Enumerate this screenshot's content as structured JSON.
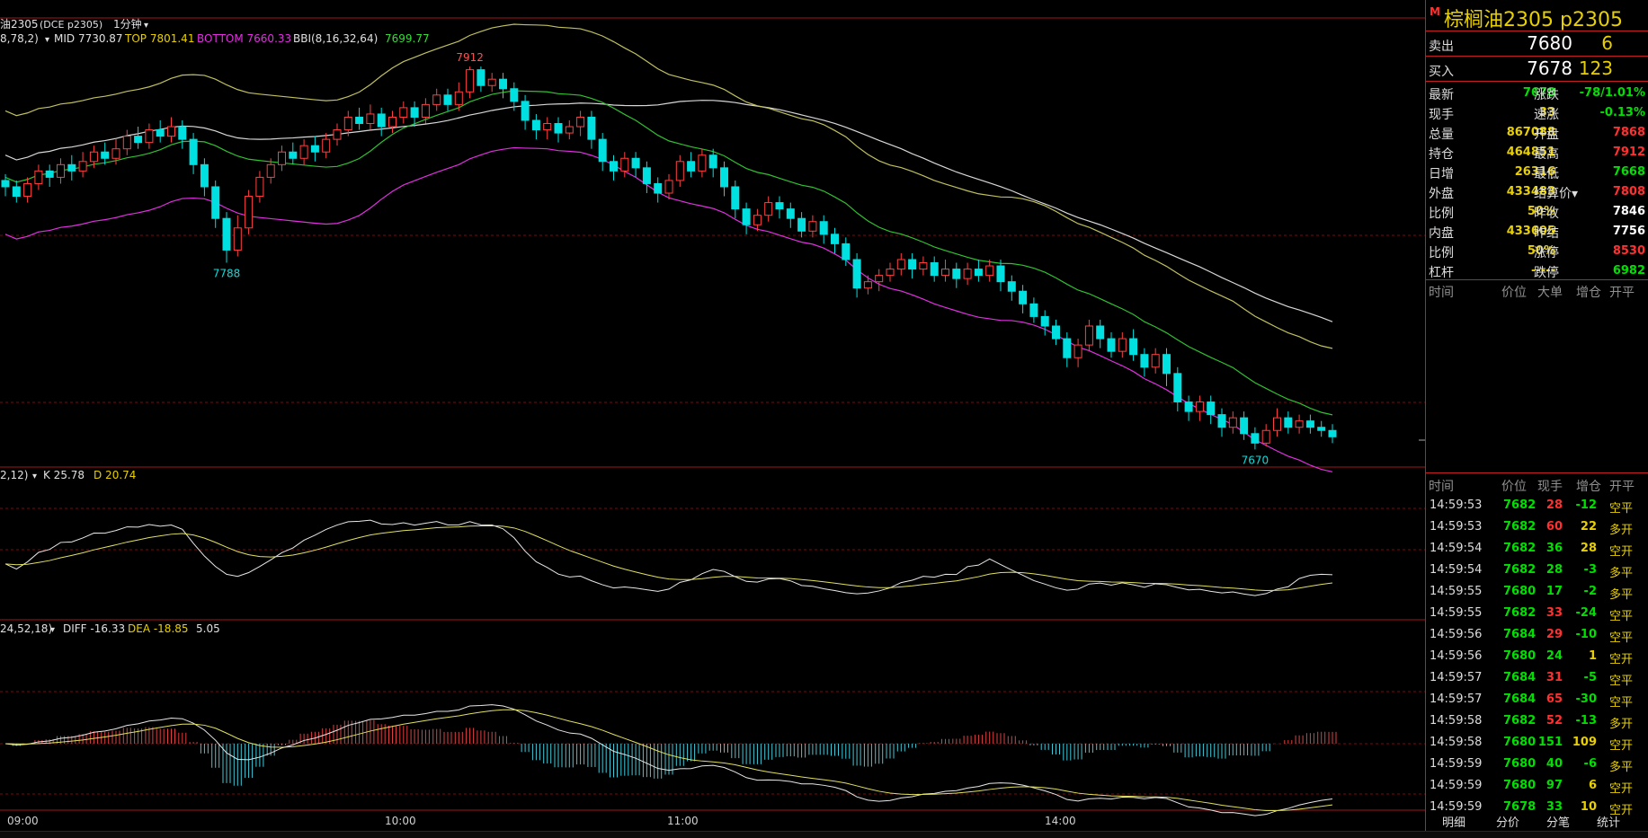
{
  "main_panel": {
    "header": {
      "code": "油2305",
      "exchange": "(DCE p2305)",
      "period": "1分钟",
      "indicator": "8,78,2)",
      "mid": "MID 7730.87",
      "top": "TOP 7801.41",
      "bottom": "BOTTOM 7660.33",
      "bbi_label": "BBI(8,16,32,64)",
      "bbi_value": "7699.77"
    },
    "high_label": "7912",
    "low_label": "7788",
    "low2_label": "7670"
  },
  "kd_panel": {
    "params": "2,12)",
    "k": "K 25.78",
    "d": "D 20.74"
  },
  "macd_panel": {
    "params": "24,52,18)",
    "diff": "DIFF -16.33",
    "dea": "DEA -18.85",
    "macd": "5.05"
  },
  "time_axis": [
    "09:00",
    "10:00",
    "11:00",
    "14:00"
  ],
  "colors": {
    "up": "#ff4040",
    "down": "#00e0e0",
    "mid": "#30c030",
    "top": "#c0c060",
    "bottom": "#e030e0",
    "bbi": "#d8d8d8",
    "grid": "#a01818",
    "k": "#e8e8e8",
    "d": "#e0e060",
    "yellow": "#e8d000",
    "green": "#00e000",
    "red": "#ff3030"
  },
  "chart_data": {
    "type": "candlestick",
    "x_ticks": [
      "09:00",
      "10:00",
      "11:00",
      "14:00"
    ],
    "y_range": [
      7660,
      7920
    ],
    "annotations": [
      {
        "label": "7912",
        "type": "high"
      },
      {
        "label": "7788",
        "type": "local-low"
      },
      {
        "label": "7670",
        "type": "low"
      }
    ],
    "candles": [
      [
        7840,
        7836,
        7844,
        7830
      ],
      [
        7836,
        7830,
        7840,
        7826
      ],
      [
        7830,
        7838,
        7842,
        7826
      ],
      [
        7838,
        7846,
        7850,
        7834
      ],
      [
        7846,
        7842,
        7850,
        7836
      ],
      [
        7842,
        7850,
        7854,
        7838
      ],
      [
        7850,
        7846,
        7856,
        7840
      ],
      [
        7846,
        7852,
        7858,
        7842
      ],
      [
        7852,
        7858,
        7862,
        7848
      ],
      [
        7858,
        7854,
        7864,
        7850
      ],
      [
        7854,
        7860,
        7866,
        7850
      ],
      [
        7860,
        7868,
        7872,
        7856
      ],
      [
        7868,
        7864,
        7874,
        7860
      ],
      [
        7864,
        7872,
        7876,
        7860
      ],
      [
        7872,
        7868,
        7878,
        7864
      ],
      [
        7868,
        7874,
        7880,
        7864
      ],
      [
        7874,
        7866,
        7878,
        7860
      ],
      [
        7866,
        7850,
        7870,
        7844
      ],
      [
        7850,
        7836,
        7854,
        7830
      ],
      [
        7836,
        7816,
        7840,
        7810
      ],
      [
        7816,
        7796,
        7820,
        7788
      ],
      [
        7796,
        7810,
        7818,
        7792
      ],
      [
        7810,
        7830,
        7834,
        7806
      ],
      [
        7830,
        7842,
        7846,
        7826
      ],
      [
        7842,
        7850,
        7854,
        7838
      ],
      [
        7850,
        7858,
        7862,
        7846
      ],
      [
        7858,
        7854,
        7864,
        7850
      ],
      [
        7854,
        7862,
        7866,
        7850
      ],
      [
        7862,
        7858,
        7868,
        7852
      ],
      [
        7858,
        7866,
        7870,
        7854
      ],
      [
        7866,
        7872,
        7876,
        7862
      ],
      [
        7872,
        7880,
        7884,
        7868
      ],
      [
        7880,
        7876,
        7886,
        7872
      ],
      [
        7876,
        7882,
        7888,
        7872
      ],
      [
        7882,
        7874,
        7886,
        7868
      ],
      [
        7874,
        7880,
        7884,
        7870
      ],
      [
        7880,
        7886,
        7890,
        7876
      ],
      [
        7886,
        7880,
        7890,
        7874
      ],
      [
        7880,
        7888,
        7892,
        7876
      ],
      [
        7888,
        7894,
        7898,
        7884
      ],
      [
        7894,
        7888,
        7898,
        7884
      ],
      [
        7888,
        7896,
        7902,
        7884
      ],
      [
        7896,
        7910,
        7912,
        7892
      ],
      [
        7910,
        7900,
        7912,
        7896
      ],
      [
        7900,
        7904,
        7908,
        7896
      ],
      [
        7904,
        7898,
        7908,
        7892
      ],
      [
        7898,
        7890,
        7902,
        7884
      ],
      [
        7890,
        7878,
        7894,
        7872
      ],
      [
        7878,
        7872,
        7882,
        7866
      ],
      [
        7872,
        7876,
        7880,
        7866
      ],
      [
        7876,
        7870,
        7880,
        7864
      ],
      [
        7870,
        7874,
        7878,
        7866
      ],
      [
        7874,
        7880,
        7884,
        7868
      ],
      [
        7880,
        7866,
        7884,
        7860
      ],
      [
        7866,
        7852,
        7870,
        7846
      ],
      [
        7852,
        7846,
        7856,
        7840
      ],
      [
        7846,
        7854,
        7858,
        7842
      ],
      [
        7854,
        7848,
        7858,
        7842
      ],
      [
        7848,
        7838,
        7852,
        7832
      ],
      [
        7838,
        7832,
        7842,
        7826
      ],
      [
        7832,
        7840,
        7844,
        7828
      ],
      [
        7840,
        7852,
        7856,
        7836
      ],
      [
        7852,
        7846,
        7858,
        7842
      ],
      [
        7846,
        7856,
        7860,
        7842
      ],
      [
        7856,
        7848,
        7860,
        7842
      ],
      [
        7848,
        7836,
        7852,
        7830
      ],
      [
        7836,
        7822,
        7840,
        7816
      ],
      [
        7822,
        7812,
        7826,
        7806
      ],
      [
        7812,
        7818,
        7822,
        7808
      ],
      [
        7818,
        7826,
        7830,
        7814
      ],
      [
        7826,
        7822,
        7830,
        7816
      ],
      [
        7822,
        7816,
        7826,
        7810
      ],
      [
        7816,
        7808,
        7820,
        7804
      ],
      [
        7808,
        7814,
        7818,
        7804
      ],
      [
        7814,
        7806,
        7818,
        7800
      ],
      [
        7806,
        7800,
        7810,
        7794
      ],
      [
        7800,
        7790,
        7804,
        7786
      ],
      [
        7790,
        7772,
        7794,
        7766
      ],
      [
        7772,
        7776,
        7780,
        7768
      ],
      [
        7776,
        7780,
        7784,
        7770
      ],
      [
        7780,
        7784,
        7788,
        7776
      ],
      [
        7784,
        7790,
        7794,
        7780
      ],
      [
        7790,
        7784,
        7794,
        7778
      ],
      [
        7784,
        7788,
        7792,
        7780
      ],
      [
        7788,
        7780,
        7792,
        7776
      ],
      [
        7780,
        7784,
        7790,
        7776
      ],
      [
        7784,
        7778,
        7788,
        7772
      ],
      [
        7778,
        7784,
        7788,
        7774
      ],
      [
        7784,
        7780,
        7790,
        7776
      ],
      [
        7780,
        7786,
        7790,
        7776
      ],
      [
        7786,
        7776,
        7790,
        7770
      ],
      [
        7776,
        7770,
        7780,
        7764
      ],
      [
        7770,
        7762,
        7774,
        7756
      ],
      [
        7762,
        7754,
        7766,
        7750
      ],
      [
        7754,
        7748,
        7758,
        7742
      ],
      [
        7748,
        7740,
        7752,
        7736
      ],
      [
        7740,
        7728,
        7744,
        7722
      ],
      [
        7728,
        7736,
        7740,
        7722
      ],
      [
        7736,
        7748,
        7752,
        7732
      ],
      [
        7748,
        7740,
        7752,
        7734
      ],
      [
        7740,
        7732,
        7744,
        7728
      ],
      [
        7732,
        7740,
        7744,
        7728
      ],
      [
        7740,
        7730,
        7746,
        7726
      ],
      [
        7730,
        7722,
        7734,
        7716
      ],
      [
        7722,
        7730,
        7734,
        7718
      ],
      [
        7730,
        7718,
        7734,
        7710
      ],
      [
        7718,
        7700,
        7722,
        7694
      ],
      [
        7700,
        7694,
        7704,
        7688
      ],
      [
        7694,
        7700,
        7704,
        7688
      ],
      [
        7700,
        7692,
        7704,
        7686
      ],
      [
        7692,
        7684,
        7696,
        7678
      ],
      [
        7684,
        7690,
        7694,
        7680
      ],
      [
        7690,
        7680,
        7694,
        7676
      ],
      [
        7680,
        7674,
        7684,
        7670
      ],
      [
        7674,
        7682,
        7686,
        7672
      ],
      [
        7682,
        7690,
        7696,
        7678
      ],
      [
        7690,
        7684,
        7694,
        7680
      ],
      [
        7684,
        7688,
        7692,
        7680
      ],
      [
        7688,
        7684,
        7692,
        7680
      ],
      [
        7684,
        7682,
        7688,
        7678
      ],
      [
        7682,
        7678,
        7686,
        7674
      ]
    ]
  },
  "quote": {
    "m_mark": "M",
    "title": "棕榈油2305  p2305",
    "sell": {
      "label": "卖出",
      "price": "7680",
      "vol": "6"
    },
    "buy": {
      "label": "买入",
      "price": "7678",
      "vol": "123"
    },
    "rows": [
      {
        "l1": "最新",
        "v1": "7678",
        "c1": "#00e000",
        "l2": "涨跌",
        "v2": "-78/1.01%",
        "c2": "#00e000"
      },
      {
        "l1": "现手",
        "v1": "33",
        "c1": "#e8d000",
        "l2": "速涨",
        "v2": "-0.13%",
        "c2": "#00e000"
      },
      {
        "l1": "总量",
        "v1": "867088",
        "c1": "#e8d000",
        "l2": "开盘",
        "v2": "7868",
        "c2": "#ff3030"
      },
      {
        "l1": "持仓",
        "v1": "464851",
        "c1": "#e8d000",
        "l2": "最高",
        "v2": "7912",
        "c2": "#ff3030"
      },
      {
        "l1": "日增",
        "v1": "26316",
        "c1": "#e8d000",
        "l2": "最低",
        "v2": "7668",
        "c2": "#00e000"
      },
      {
        "l1": "外盘",
        "v1": "433483",
        "c1": "#e8d000",
        "l2": "结算价▾",
        "v2": "7808",
        "c2": "#ff3030"
      },
      {
        "l1": "比例",
        "v1": "50%",
        "c1": "#e8d000",
        "l2": "昨收",
        "v2": "7846",
        "c2": "#ffffff"
      },
      {
        "l1": "内盘",
        "v1": "433605",
        "c1": "#e8d000",
        "l2": "昨结",
        "v2": "7756",
        "c2": "#ffffff"
      },
      {
        "l1": "比例",
        "v1": "50%",
        "c1": "#e8d000",
        "l2": "涨停",
        "v2": "8530",
        "c2": "#ff3030"
      },
      {
        "l1": "杠杆",
        "v1": "-----",
        "c1": "#e8d000",
        "l2": "跌停",
        "v2": "6982",
        "c2": "#00e000"
      }
    ],
    "big_head": {
      "time": "时间",
      "price": "价位",
      "big": "大单",
      "inc": "增仓",
      "type": "开平"
    },
    "tick_head": {
      "time": "时间",
      "price": "价位",
      "hand": "现手",
      "inc": "增仓",
      "type": "开平"
    },
    "ticks": [
      {
        "time": "14:59:53",
        "price": "7682",
        "hand": "28",
        "hc": "#ff3030",
        "inc": "-12",
        "type": "空平"
      },
      {
        "time": "14:59:53",
        "price": "7682",
        "hand": "60",
        "hc": "#ff3030",
        "inc": "22",
        "type": "多开"
      },
      {
        "time": "14:59:54",
        "price": "7682",
        "hand": "36",
        "hc": "#00e000",
        "inc": "28",
        "type": "空开"
      },
      {
        "time": "14:59:54",
        "price": "7682",
        "hand": "28",
        "hc": "#00e000",
        "inc": "-3",
        "type": "多平"
      },
      {
        "time": "14:59:55",
        "price": "7680",
        "hand": "17",
        "hc": "#00e000",
        "inc": "-2",
        "type": "多平"
      },
      {
        "time": "14:59:55",
        "price": "7682",
        "hand": "33",
        "hc": "#ff3030",
        "inc": "-24",
        "type": "空平"
      },
      {
        "time": "14:59:56",
        "price": "7684",
        "hand": "29",
        "hc": "#ff3030",
        "inc": "-10",
        "type": "空平"
      },
      {
        "time": "14:59:56",
        "price": "7680",
        "hand": "24",
        "hc": "#00e000",
        "inc": "1",
        "type": "空开"
      },
      {
        "time": "14:59:57",
        "price": "7684",
        "hand": "31",
        "hc": "#ff3030",
        "inc": "-5",
        "type": "空平"
      },
      {
        "time": "14:59:57",
        "price": "7684",
        "hand": "65",
        "hc": "#ff3030",
        "inc": "-30",
        "type": "空平"
      },
      {
        "time": "14:59:58",
        "price": "7682",
        "hand": "52",
        "hc": "#ff3030",
        "inc": "-13",
        "type": "多开"
      },
      {
        "time": "14:59:58",
        "price": "7680",
        "hand": "151",
        "hc": "#00e000",
        "inc": "109",
        "type": "空开"
      },
      {
        "time": "14:59:59",
        "price": "7680",
        "hand": "40",
        "hc": "#00e000",
        "inc": "-6",
        "type": "多平"
      },
      {
        "time": "14:59:59",
        "price": "7680",
        "hand": "97",
        "hc": "#00e000",
        "inc": "6",
        "type": "空开"
      },
      {
        "time": "14:59:59",
        "price": "7678",
        "hand": "33",
        "hc": "#00e000",
        "inc": "10",
        "type": "空开"
      }
    ],
    "tabs": [
      "明细",
      "分价",
      "分笔",
      "统计"
    ]
  }
}
